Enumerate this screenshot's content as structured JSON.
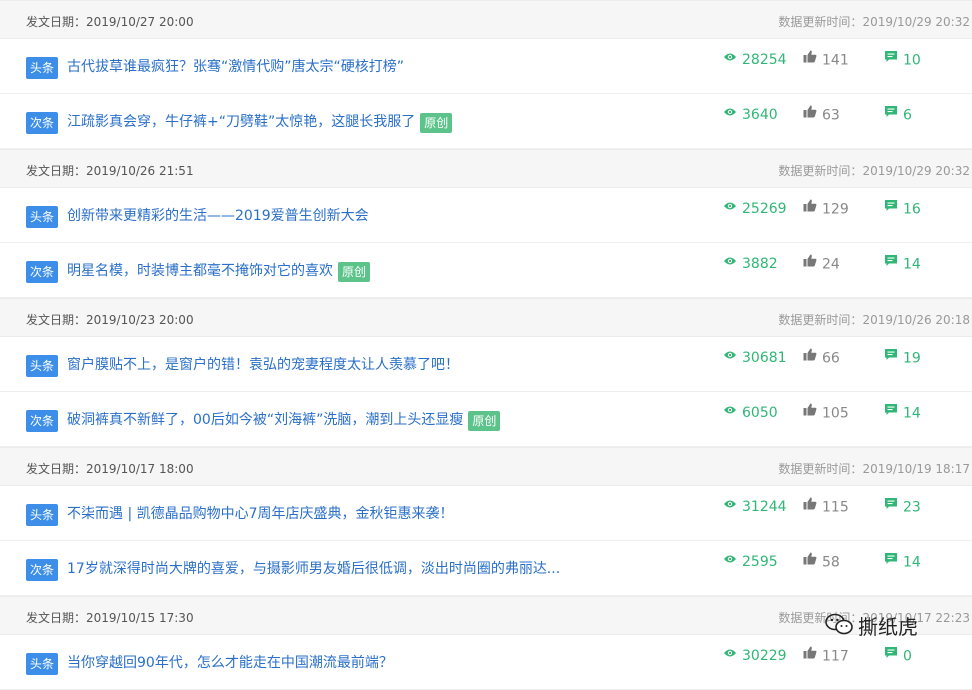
{
  "labels": {
    "publish_prefix": "发文日期：",
    "update_prefix": "数据更新时间：",
    "original_badge": "原创"
  },
  "groups": [
    {
      "publish_date": "2019/10/27 20:00",
      "update_time": "2019/10/29 20:32",
      "items": [
        {
          "tag": "头条",
          "title": "古代拔草谁最疯狂？张骞“激情代购”唐太宗“硬核打榜”",
          "original": false,
          "views": "28254",
          "likes": "141",
          "comments": "10"
        },
        {
          "tag": "次条",
          "title": "江疏影真会穿，牛仔裤+“刀劈鞋”太惊艳，这腿长我服了",
          "original": true,
          "views": "3640",
          "likes": "63",
          "comments": "6"
        }
      ]
    },
    {
      "publish_date": "2019/10/26 21:51",
      "update_time": "2019/10/29 20:32",
      "items": [
        {
          "tag": "头条",
          "title": "创新带来更精彩的生活——2019爱普生创新大会",
          "original": false,
          "views": "25269",
          "likes": "129",
          "comments": "16"
        },
        {
          "tag": "次条",
          "title": "明星名模，时装博主都毫不掩饰对它的喜欢",
          "original": true,
          "views": "3882",
          "likes": "24",
          "comments": "14"
        }
      ]
    },
    {
      "publish_date": "2019/10/23 20:00",
      "update_time": "2019/10/26 20:18",
      "items": [
        {
          "tag": "头条",
          "title": "窗户膜贴不上，是窗户的错！袁弘的宠妻程度太让人羡慕了吧！",
          "original": false,
          "views": "30681",
          "likes": "66",
          "comments": "19"
        },
        {
          "tag": "次条",
          "title": "破洞裤真不新鲜了，00后如今被“刘海裤”洗脑，潮到上头还显瘦",
          "original": true,
          "views": "6050",
          "likes": "105",
          "comments": "14"
        }
      ]
    },
    {
      "publish_date": "2019/10/17 18:00",
      "update_time": "2019/10/19 18:17",
      "items": [
        {
          "tag": "头条",
          "title": "不柒而遇 | 凯德晶品购物中心7周年店庆盛典，金秋钜惠来袭！",
          "original": false,
          "views": "31244",
          "likes": "115",
          "comments": "23"
        },
        {
          "tag": "次条",
          "title": "17岁就深得时尚大牌的喜爱，与摄影师男友婚后很低调，淡出时尚圈的弗丽达...",
          "original": false,
          "views": "2595",
          "likes": "58",
          "comments": "14"
        }
      ]
    },
    {
      "publish_date": "2019/10/15 17:30",
      "update_time": "2019/10/17 22:23",
      "items": [
        {
          "tag": "头条",
          "title": "当你穿越回90年代，怎么才能走在中国潮流最前端？",
          "original": false,
          "views": "30229",
          "likes": "117",
          "comments": "0"
        }
      ]
    }
  ],
  "watermark": {
    "text": "撕纸虎",
    "icon": "wechat-icon"
  },
  "colors": {
    "tag_blue": "#3d8ee9",
    "title_blue": "#2a6fc9",
    "accent_green": "#30b676",
    "badge_green": "#5cc38a",
    "header_bg": "#f6f6f6"
  },
  "icons": {
    "views": "eye-icon",
    "likes": "thumbs-up-icon",
    "comments": "comment-icon"
  }
}
